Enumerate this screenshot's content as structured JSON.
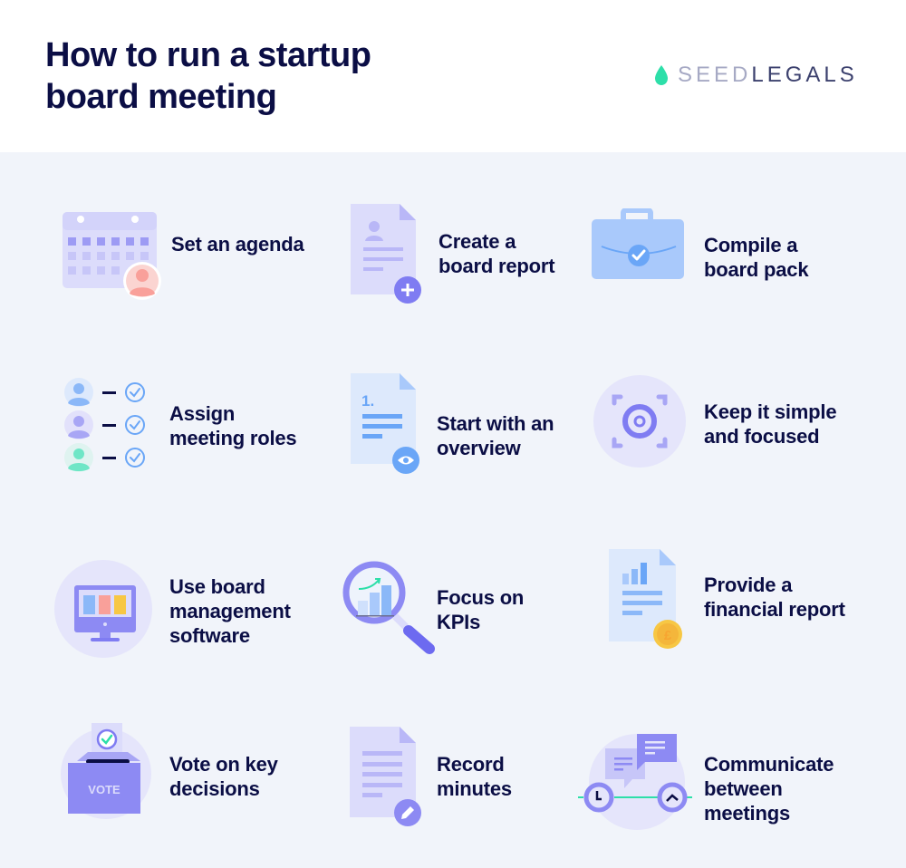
{
  "header": {
    "title_line1": "How to run a startup",
    "title_line2": "board meeting",
    "logo": {
      "part1": "SEED",
      "part2": "LEGALS",
      "icon": "drop-icon"
    }
  },
  "colors": {
    "navy": "#0b0e45",
    "background": "#f1f4fa",
    "lavender": "#dcdcfb",
    "purple": "#7f7cf2",
    "blue": "#6aa6f7",
    "light_blue": "#dde9fc",
    "teal": "#2ddfa9",
    "coral": "#f9a09a",
    "gold": "#f7c744"
  },
  "steps": [
    {
      "label_lines": [
        "Set an agenda"
      ],
      "icon": "calendar-icon"
    },
    {
      "label_lines": [
        "Create a",
        "board report"
      ],
      "icon": "document-plus-icon"
    },
    {
      "label_lines": [
        "Compile a",
        "board pack"
      ],
      "icon": "briefcase-check-icon"
    },
    {
      "label_lines": [
        "Assign",
        "meeting roles"
      ],
      "icon": "assign-roles-icon"
    },
    {
      "label_lines": [
        "Start with an",
        "overview"
      ],
      "icon": "document-eye-icon"
    },
    {
      "label_lines": [
        "Keep it simple",
        "and focused"
      ],
      "icon": "focus-target-icon"
    },
    {
      "label_lines": [
        "Use board",
        "management",
        "software"
      ],
      "icon": "monitor-icon"
    },
    {
      "label_lines": [
        "Focus on",
        "KPIs"
      ],
      "icon": "magnifier-chart-icon"
    },
    {
      "label_lines": [
        "Provide a",
        "financial report"
      ],
      "icon": "document-pound-icon"
    },
    {
      "label_lines": [
        "Vote on key",
        "decisions"
      ],
      "icon": "ballot-box-icon"
    },
    {
      "label_lines": [
        "Record",
        "minutes"
      ],
      "icon": "document-pencil-icon"
    },
    {
      "label_lines": [
        "Communicate",
        "between",
        "meetings"
      ],
      "icon": "chat-clock-icon"
    }
  ],
  "ballot_box_text": "VOTE",
  "document_number": "1.",
  "currency_symbol": "£"
}
